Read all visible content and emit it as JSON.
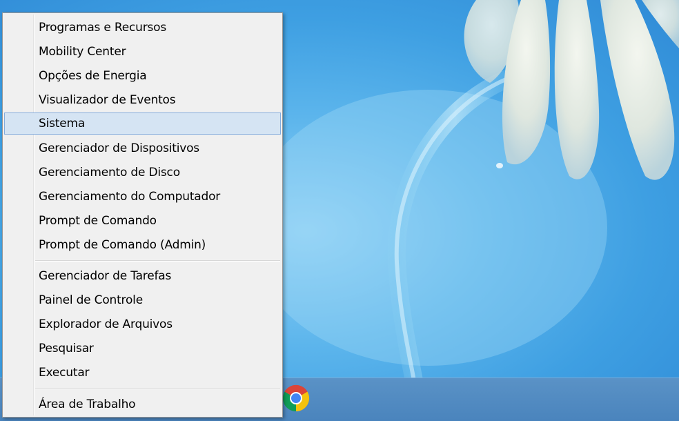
{
  "menu": {
    "items": [
      {
        "label": "Programas e Recursos"
      },
      {
        "label": "Mobility Center"
      },
      {
        "label": "Opções de Energia"
      },
      {
        "label": "Visualizador de Eventos"
      },
      {
        "label": "Sistema",
        "highlighted": true
      },
      {
        "label": "Gerenciador de Dispositivos"
      },
      {
        "label": "Gerenciamento de Disco"
      },
      {
        "label": "Gerenciamento do Computador"
      },
      {
        "label": "Prompt de Comando"
      },
      {
        "label": "Prompt de Comando (Admin)"
      },
      {
        "label": "Gerenciador de Tarefas"
      },
      {
        "label": "Painel de Controle"
      },
      {
        "label": "Explorador de Arquivos"
      },
      {
        "label": "Pesquisar"
      },
      {
        "label": "Executar"
      },
      {
        "label": "Área de Trabalho"
      }
    ]
  },
  "taskbar": {
    "pinned_apps": [
      {
        "icon": "chrome-icon"
      }
    ]
  },
  "colors": {
    "highlight_fill": "#d5e4f3",
    "highlight_border": "#84acdd",
    "menu_background": "#f0f0f0",
    "taskbar": "#4f89c1",
    "desktop_blue": "#4aa8e6"
  }
}
